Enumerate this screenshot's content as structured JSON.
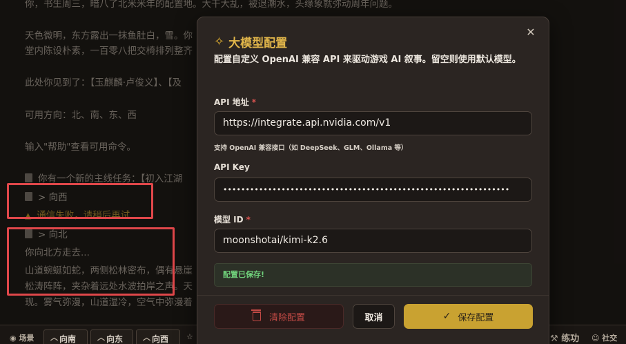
{
  "log": {
    "line_top": "你，书生周三，暗八了北米米年的配置地。大干大乱，被退潮水，头缘象就弥动周年问题。",
    "line_dawn_a": "天色微明，东方露出一抹鱼肚白，雪。你",
    "line_dawn_b": "堂内陈设朴素，一百零八把交椅排列整齐",
    "line_seen": "此处你见到了：【玉麒麟·卢俊义】、【及",
    "line_dirs": "可用方向：北、南、东、西",
    "line_help": "输入\"帮助\"查看可用命令。",
    "line_quest": "你有一个新的主线任务：【初入江湖",
    "cmd_west": "> 向西",
    "warn_line": "通信失败，请稍后再试",
    "cmd_north": "> 向北",
    "line_north": "你向北方走去...",
    "line_path_a": "山道蜿蜒如蛇，两侧松林密布，偶有悬崖",
    "line_path_b": "松涛阵阵，夹杂着远处水波拍岸之声。天",
    "line_path_c": "现。雾气弥漫，山道湿冷，空气中弥漫着"
  },
  "bottombar": {
    "scene": "场景",
    "dir_south": "向南",
    "dir_east": "向东",
    "dir_west": "向西",
    "practice": "练功",
    "social": "社交"
  },
  "modal": {
    "title": "大模型配置",
    "description": "配置自定义 OpenAI 兼容 API 来驱动游戏 AI 叙事。留空则使用默认模型。",
    "api_url_label": "API 地址",
    "api_url_value": "https://integrate.api.nvidia.com/v1",
    "api_url_hint": "支持 OpenAI 兼容接口（如 DeepSeek、GLM、Ollama 等）",
    "api_key_label": "API Key",
    "api_key_value": "••••••••••••••••••••••••••••••••••••••••••••••••••••••••••••••••",
    "model_label": "模型 ID",
    "model_value": "moonshotai/kimi-k2.6",
    "saved_status": "配置已保存!",
    "clear_label": "清除配置",
    "cancel_label": "取消",
    "save_label": "保存配置",
    "required_mark": "*"
  },
  "colors": {
    "accent": "#c9a231",
    "title": "#e0b54a",
    "danger": "#c24a45",
    "success": "#6fcf7a",
    "highlight": "#e0474a"
  }
}
